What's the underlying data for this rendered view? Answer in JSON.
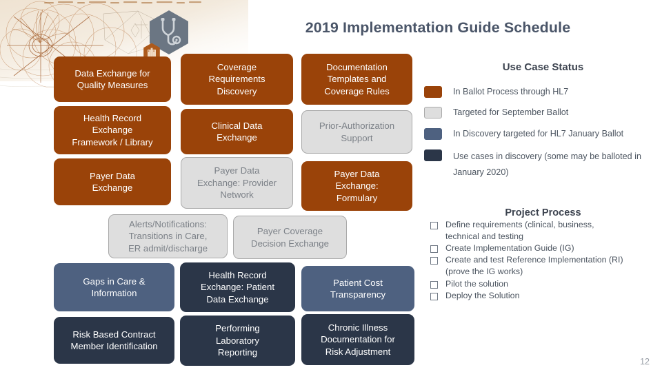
{
  "slide": {
    "title": "2019 Implementation Guide Schedule",
    "page_number": "12"
  },
  "icons": {
    "stethoscope": "stethoscope-icon",
    "hospital": "hospital-building-icon"
  },
  "colors": {
    "orange": "#9a4309",
    "light_gray": "#dedede",
    "gray_border": "#a9a9a9",
    "slate_blue": "#4e6180",
    "dark_navy": "#2b3648",
    "title_text": "#4a5568"
  },
  "use_case_boxes": [
    {
      "id": "data-exchange-quality-measures",
      "label": "Data Exchange for\nQuality Measures",
      "status": "orange"
    },
    {
      "id": "coverage-requirements-discovery",
      "label": "Coverage\nRequirements\nDiscovery",
      "status": "orange"
    },
    {
      "id": "documentation-templates-coverage",
      "label": "Documentation\nTemplates and\nCoverage Rules",
      "status": "orange"
    },
    {
      "id": "health-record-exchange-framework",
      "label": "Health Record\nExchange\nFramework / Library",
      "status": "orange"
    },
    {
      "id": "clinical-data-exchange",
      "label": "Clinical Data\nExchange",
      "status": "orange"
    },
    {
      "id": "prior-authorization-support",
      "label": "Prior-Authorization\nSupport",
      "status": "gray"
    },
    {
      "id": "payer-data-exchange",
      "label": "Payer Data\nExchange",
      "status": "orange"
    },
    {
      "id": "payer-data-exchange-provider-net",
      "label": "Payer Data\nExchange: Provider\nNetwork",
      "status": "gray"
    },
    {
      "id": "payer-data-exchange-formulary",
      "label": "Payer Data\nExchange:\nFormulary",
      "status": "orange"
    },
    {
      "id": "alerts-notifications",
      "label": "Alerts/Notifications:\nTransitions in Care,\nER admit/discharge",
      "status": "gray"
    },
    {
      "id": "payer-coverage-decision-exchange",
      "label": "Payer Coverage\nDecision Exchange",
      "status": "gray"
    },
    {
      "id": "gaps-in-care-information",
      "label": "Gaps in Care &\nInformation",
      "status": "slate"
    },
    {
      "id": "health-record-exchange-patient",
      "label": "Health Record\nExchange: Patient\nData Exchange",
      "status": "navy"
    },
    {
      "id": "patient-cost-transparency",
      "label": "Patient Cost\nTransparency",
      "status": "slate"
    },
    {
      "id": "risk-based-contract-member-id",
      "label": "Risk Based Contract\nMember Identification",
      "status": "navy"
    },
    {
      "id": "performing-laboratory-reporting",
      "label": "Performing\nLaboratory\nReporting",
      "status": "navy"
    },
    {
      "id": "chronic-illness-documentation",
      "label": "Chronic Illness\nDocumentation  for\nRisk Adjustment",
      "status": "navy"
    }
  ],
  "legend": {
    "title": "Use Case Status",
    "items": [
      {
        "swatch": "orange",
        "label": "In Ballot Process through HL7"
      },
      {
        "swatch": "gray",
        "label": "Targeted for September Ballot"
      },
      {
        "swatch": "slate",
        "label": "In Discovery targeted for HL7 January Ballot"
      },
      {
        "swatch": "navy",
        "label": "Use cases in discovery (some may be balloted in\nJanuary 2020)"
      }
    ]
  },
  "project_process": {
    "title": "Project Process",
    "items": [
      "Define requirements (clinical, business,\ntechnical and testing",
      "Create Implementation Guide (IG)",
      "Create and test Reference Implementation  (RI)\n(prove the IG works)",
      "Pilot the solution",
      "Deploy the Solution"
    ]
  }
}
